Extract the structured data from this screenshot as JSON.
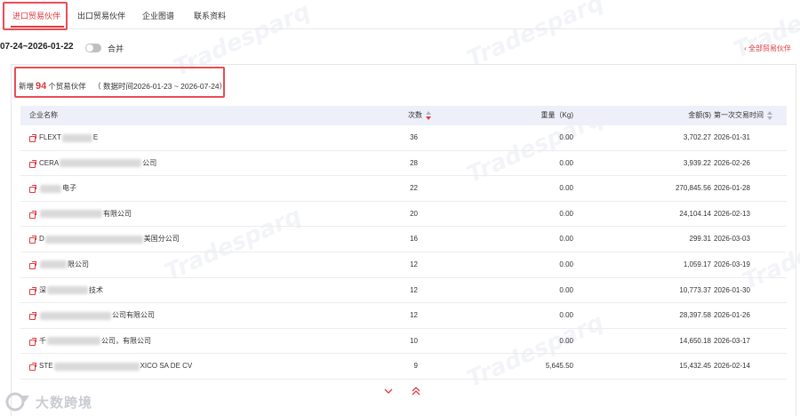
{
  "tabs": [
    {
      "label": "进口贸易伙伴",
      "active": true
    },
    {
      "label": "出口贸易伙伴",
      "active": false
    },
    {
      "label": "企业图谱",
      "active": false
    },
    {
      "label": "联系资料",
      "active": false
    }
  ],
  "filter": {
    "date_range": "07-24~2026-01-22",
    "merge_label": "合并",
    "merge_on": false,
    "all_partners_label": "‹ 全部贸易伙伴"
  },
  "summary": {
    "prefix": "新增",
    "count": "94",
    "suffix": "个贸易伙伴",
    "data_time": "（ 数据时间2026-01-23 ~ 2026-07-24）"
  },
  "table": {
    "columns": {
      "name": "企业名称",
      "count": "次数",
      "weight": "重量（Kg)",
      "amount": "金额($)",
      "first_date": "第一次交易时间"
    },
    "rows": [
      {
        "name_start": "FLEXT",
        "name_end": "E",
        "count": "36",
        "weight": "0.00",
        "amount": "3,702.27",
        "date": "2026-01-31"
      },
      {
        "name_start": "CERA",
        "name_end": "公司",
        "count": "28",
        "weight": "0.00",
        "amount": "3,939.22",
        "date": "2026-02-26"
      },
      {
        "name_start": "",
        "name_end": "电子",
        "count": "22",
        "weight": "0.00",
        "amount": "270,845.56",
        "date": "2026-01-28"
      },
      {
        "name_start": "",
        "name_end": "有限公司",
        "count": "20",
        "weight": "0.00",
        "amount": "24,104.14",
        "date": "2026-02-13"
      },
      {
        "name_start": "D",
        "name_end": "美国分公司",
        "count": "16",
        "weight": "0.00",
        "amount": "299.31",
        "date": "2026-03-03"
      },
      {
        "name_start": "",
        "name_end": "限公司",
        "count": "12",
        "weight": "0.00",
        "amount": "1,059.17",
        "date": "2026-03-19"
      },
      {
        "name_start": "深",
        "name_end": "技术",
        "count": "12",
        "weight": "0.00",
        "amount": "10,773.37",
        "date": "2026-01-30"
      },
      {
        "name_start": "",
        "name_end": "公司有限公司",
        "count": "12",
        "weight": "0.00",
        "amount": "28,397.58",
        "date": "2026-01-26"
      },
      {
        "name_start": "千",
        "name_end": "公司，有限公司",
        "count": "10",
        "weight": "0.00",
        "amount": "14,650.18",
        "date": "2026-03-17"
      },
      {
        "name_start": "STE",
        "name_end": "XICO SA DE CV",
        "count": "9",
        "weight": "5,645.50",
        "amount": "15,432.45",
        "date": "2026-02-14"
      }
    ]
  },
  "logo": {
    "text": "大数跨境"
  },
  "colors": {
    "accent": "#e0383e",
    "header_bg": "#edf0f8"
  }
}
